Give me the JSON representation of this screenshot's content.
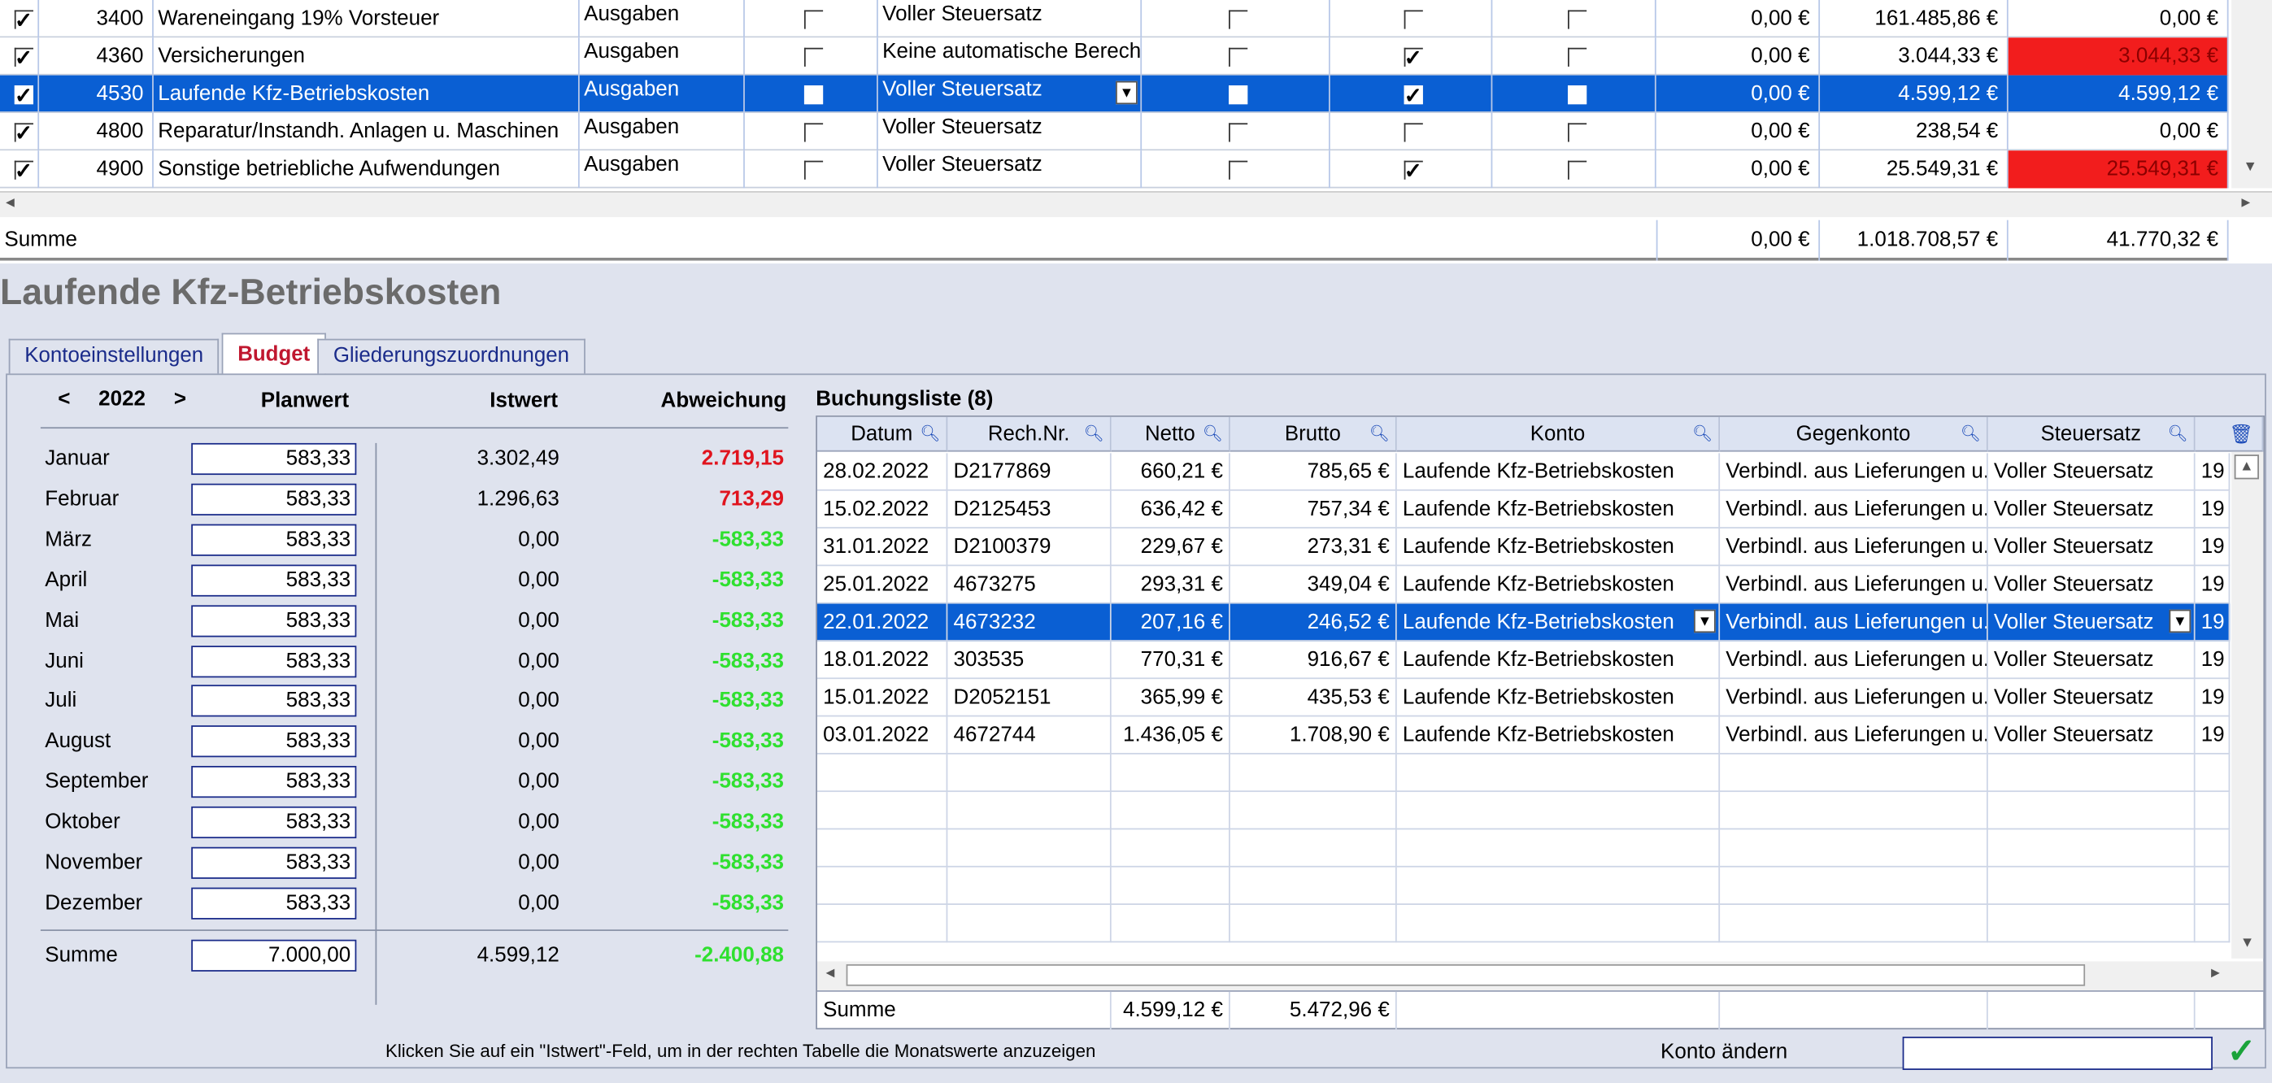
{
  "top_rows": [
    {
      "check": true,
      "num": "3400",
      "name": "Wareneingang 19% Vorsteuer",
      "type": "Ausgaben",
      "c1": false,
      "tax": "Voller Steuersatz",
      "c2": false,
      "c3": false,
      "c4": false,
      "v1": "0,00 €",
      "v2": "161.485,86 €",
      "v3": "0,00 €",
      "red": false,
      "selected": false
    },
    {
      "check": true,
      "num": "4360",
      "name": "Versicherungen",
      "type": "Ausgaben",
      "c1": false,
      "tax": "Keine automatische Berech",
      "c2": false,
      "c3": true,
      "c4": false,
      "v1": "0,00 €",
      "v2": "3.044,33 €",
      "v3": "3.044,33 €",
      "red": true,
      "selected": false
    },
    {
      "check": true,
      "num": "4530",
      "name": "Laufende Kfz-Betriebskosten",
      "type": "Ausgaben",
      "c1": false,
      "tax": "Voller Steuersatz",
      "c2": false,
      "c3": true,
      "c4": false,
      "v1": "0,00 €",
      "v2": "4.599,12 €",
      "v3": "4.599,12 €",
      "red": false,
      "selected": true
    },
    {
      "check": true,
      "num": "4800",
      "name": "Reparatur/Instandh. Anlagen u. Maschinen",
      "type": "Ausgaben",
      "c1": false,
      "tax": "Voller Steuersatz",
      "c2": false,
      "c3": false,
      "c4": false,
      "v1": "0,00 €",
      "v2": "238,54 €",
      "v3": "0,00 €",
      "red": false,
      "selected": false
    },
    {
      "check": true,
      "num": "4900",
      "name": "Sonstige betriebliche Aufwendungen",
      "type": "Ausgaben",
      "c1": false,
      "tax": "Voller Steuersatz",
      "c2": false,
      "c3": true,
      "c4": false,
      "v1": "0,00 €",
      "v2": "25.549,31 €",
      "v3": "25.549,31 €",
      "red": true,
      "selected": false
    }
  ],
  "top_sum": {
    "label": "Summe",
    "v1": "0,00 €",
    "v2": "1.018.708,57 €",
    "v3": "41.770,32 €"
  },
  "title": "Laufende Kfz-Betriebskosten",
  "tabs": [
    "Kontoeinstellungen",
    "Budget",
    "Gliederungszuordnungen"
  ],
  "budget": {
    "prev": "<",
    "year": "2022",
    "next": ">",
    "col_plan": "Planwert",
    "col_ist": "Istwert",
    "col_abw": "Abweichung",
    "months": [
      {
        "m": "Januar",
        "plan": "583,33",
        "ist": "3.302,49",
        "abw": "2.719,15",
        "pos": true
      },
      {
        "m": "Februar",
        "plan": "583,33",
        "ist": "1.296,63",
        "abw": "713,29",
        "pos": true
      },
      {
        "m": "März",
        "plan": "583,33",
        "ist": "0,00",
        "abw": "-583,33",
        "pos": false
      },
      {
        "m": "April",
        "plan": "583,33",
        "ist": "0,00",
        "abw": "-583,33",
        "pos": false
      },
      {
        "m": "Mai",
        "plan": "583,33",
        "ist": "0,00",
        "abw": "-583,33",
        "pos": false
      },
      {
        "m": "Juni",
        "plan": "583,33",
        "ist": "0,00",
        "abw": "-583,33",
        "pos": false
      },
      {
        "m": "Juli",
        "plan": "583,33",
        "ist": "0,00",
        "abw": "-583,33",
        "pos": false
      },
      {
        "m": "August",
        "plan": "583,33",
        "ist": "0,00",
        "abw": "-583,33",
        "pos": false
      },
      {
        "m": "September",
        "plan": "583,33",
        "ist": "0,00",
        "abw": "-583,33",
        "pos": false
      },
      {
        "m": "Oktober",
        "plan": "583,33",
        "ist": "0,00",
        "abw": "-583,33",
        "pos": false
      },
      {
        "m": "November",
        "plan": "583,33",
        "ist": "0,00",
        "abw": "-583,33",
        "pos": false
      },
      {
        "m": "Dezember",
        "plan": "583,33",
        "ist": "0,00",
        "abw": "-583,33",
        "pos": false
      }
    ],
    "sum": {
      "m": "Summe",
      "plan": "7.000,00",
      "ist": "4.599,12",
      "abw": "-2.400,88"
    }
  },
  "list": {
    "title": "Buchungsliste (8)",
    "headers": [
      "Datum",
      "Rech.Nr.",
      "Netto",
      "Brutto",
      "Konto",
      "Gegenkonto",
      "Steuersatz"
    ],
    "rows": [
      {
        "d": "28.02.2022",
        "r": "D2177869",
        "n": "660,21 €",
        "b": "785,65 €",
        "k": "Laufende Kfz-Betriebskosten",
        "g": "Verbindl. aus Lieferungen u.",
        "s": "Voller Steuersatz",
        "x": "19"
      },
      {
        "d": "15.02.2022",
        "r": "D2125453",
        "n": "636,42 €",
        "b": "757,34 €",
        "k": "Laufende Kfz-Betriebskosten",
        "g": "Verbindl. aus Lieferungen u.",
        "s": "Voller Steuersatz",
        "x": "19"
      },
      {
        "d": "31.01.2022",
        "r": "D2100379",
        "n": "229,67 €",
        "b": "273,31 €",
        "k": "Laufende Kfz-Betriebskosten",
        "g": "Verbindl. aus Lieferungen u.",
        "s": "Voller Steuersatz",
        "x": "19"
      },
      {
        "d": "25.01.2022",
        "r": "4673275",
        "n": "293,31 €",
        "b": "349,04 €",
        "k": "Laufende Kfz-Betriebskosten",
        "g": "Verbindl. aus Lieferungen u.",
        "s": "Voller Steuersatz",
        "x": "19"
      },
      {
        "d": "22.01.2022",
        "r": "4673232",
        "n": "207,16 €",
        "b": "246,52 €",
        "k": "Laufende Kfz-Betriebskosten",
        "g": "Verbindl. aus Lieferungen u.",
        "s": "Voller Steuersatz",
        "x": "19",
        "sel": true
      },
      {
        "d": "18.01.2022",
        "r": "303535",
        "n": "770,31 €",
        "b": "916,67 €",
        "k": "Laufende Kfz-Betriebskosten",
        "g": "Verbindl. aus Lieferungen u.",
        "s": "Voller Steuersatz",
        "x": "19"
      },
      {
        "d": "15.01.2022",
        "r": "D2052151",
        "n": "365,99 €",
        "b": "435,53 €",
        "k": "Laufende Kfz-Betriebskosten",
        "g": "Verbindl. aus Lieferungen u.",
        "s": "Voller Steuersatz",
        "x": "19"
      },
      {
        "d": "03.01.2022",
        "r": "4672744",
        "n": "1.436,05 €",
        "b": "1.708,90 €",
        "k": "Laufende Kfz-Betriebskosten",
        "g": "Verbindl. aus Lieferungen u.",
        "s": "Voller Steuersatz",
        "x": "19"
      }
    ],
    "sum": {
      "label": "Summe",
      "n": "4.599,12 €",
      "b": "5.472,96 €"
    }
  },
  "footer": {
    "hint": "Klicken Sie auf ein \"Istwert\"-Feld, um in der rechten Tabelle die Monatswerte anzuzeigen",
    "konto_label": "Konto ändern",
    "konto_value": ""
  },
  "colors": {
    "selection": "#0a5fd3",
    "negative": "#2fe02f",
    "positive": "#e0141e",
    "over_budget": "#f21d1d",
    "title": "#6b6b6b",
    "active_tab": "#c0172f"
  }
}
